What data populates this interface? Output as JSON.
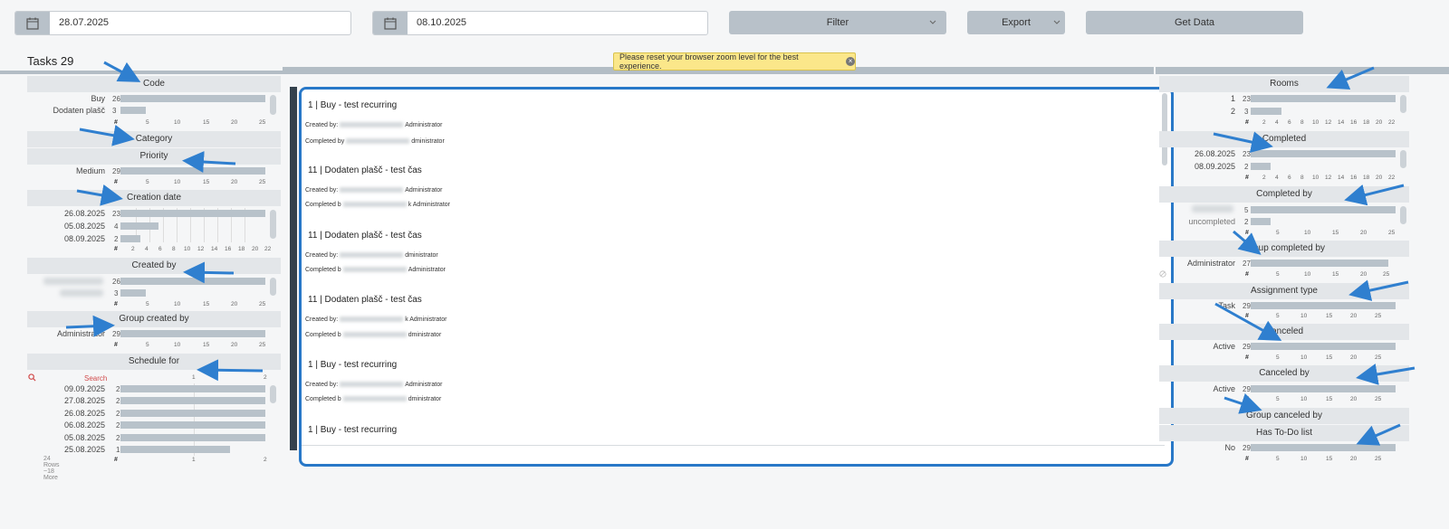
{
  "toolbar": {
    "date_from": "28.07.2025",
    "date_to": "08.10.2025",
    "filter_label": "Filter",
    "export_label": "Export",
    "get_data_label": "Get Data"
  },
  "tasks_title": "Tasks 29",
  "toast": "Please reset your browser zoom level for the best experience.",
  "left": {
    "code": {
      "header": "Code",
      "rows": [
        {
          "label": "Buy",
          "count": "26"
        },
        {
          "label": "Dodaten plašč",
          "count": "3"
        }
      ],
      "ticks": [
        "#",
        "5",
        "10",
        "15",
        "20",
        "25"
      ]
    },
    "category": {
      "header": "Category"
    },
    "priority": {
      "header": "Priority",
      "rows": [
        {
          "label": "Medium",
          "count": "29"
        }
      ],
      "ticks": [
        "#",
        "5",
        "10",
        "15",
        "20",
        "25"
      ]
    },
    "creation_date": {
      "header": "Creation date",
      "rows": [
        {
          "label": "26.08.2025",
          "count": "23"
        },
        {
          "label": "05.08.2025",
          "count": "4"
        },
        {
          "label": "08.09.2025",
          "count": "2"
        }
      ],
      "ticks": [
        "#",
        "2",
        "4",
        "6",
        "8",
        "10",
        "12",
        "14",
        "16",
        "18",
        "20",
        "22"
      ]
    },
    "created_by": {
      "header": "Created by",
      "rows": [
        {
          "label": "",
          "count": "26"
        },
        {
          "label": "",
          "count": "3"
        }
      ],
      "ticks": [
        "#",
        "5",
        "10",
        "15",
        "20",
        "25"
      ]
    },
    "group_created_by": {
      "header": "Group created by",
      "rows": [
        {
          "label": "Administrator",
          "count": "29"
        }
      ],
      "ticks": [
        "#",
        "5",
        "10",
        "15",
        "20",
        "25"
      ]
    },
    "schedule_for": {
      "header": "Schedule for",
      "search": "Search",
      "top_ticks": [
        "1",
        "2"
      ],
      "rows": [
        {
          "label": "09.09.2025",
          "count": "2"
        },
        {
          "label": "27.08.2025",
          "count": "2"
        },
        {
          "label": "26.08.2025",
          "count": "2"
        },
        {
          "label": "06.08.2025",
          "count": "2"
        },
        {
          "label": "05.08.2025",
          "count": "2"
        },
        {
          "label": "25.08.2025",
          "count": "1"
        }
      ],
      "footer": "24 Rows ~18 More",
      "ticks": [
        "#",
        "1",
        "2"
      ]
    }
  },
  "right": {
    "rooms": {
      "header": "Rooms",
      "rows": [
        {
          "label": "1",
          "count": "23"
        },
        {
          "label": "2",
          "count": "3"
        }
      ],
      "ticks": [
        "#",
        "2",
        "4",
        "6",
        "8",
        "10",
        "12",
        "14",
        "16",
        "18",
        "20",
        "22"
      ]
    },
    "completed": {
      "header": "Completed",
      "rows": [
        {
          "label": "26.08.2025",
          "count": "23"
        },
        {
          "label": "08.09.2025",
          "count": "2"
        }
      ],
      "ticks": [
        "#",
        "2",
        "4",
        "6",
        "8",
        "10",
        "12",
        "14",
        "16",
        "18",
        "20",
        "22"
      ]
    },
    "completed_by": {
      "header": "Completed by",
      "rows": [
        {
          "label": "",
          "count": "5"
        },
        {
          "label": "uncompleted",
          "count": "2"
        }
      ],
      "ticks": [
        "#",
        "5",
        "10",
        "15",
        "20",
        "25"
      ]
    },
    "group_completed_by": {
      "header": "Group completed by",
      "rows": [
        {
          "label": "Administrator",
          "count": "27"
        }
      ],
      "ticks": [
        "#",
        "5",
        "10",
        "15",
        "20",
        "25"
      ]
    },
    "assignment_type": {
      "header": "Assignment type",
      "rows": [
        {
          "label": "Task",
          "count": "29"
        }
      ],
      "ticks": [
        "#",
        "5",
        "10",
        "15",
        "20",
        "25"
      ]
    },
    "canceled": {
      "header": "Canceled",
      "rows": [
        {
          "label": "Active",
          "count": "29"
        }
      ],
      "ticks": [
        "#",
        "5",
        "10",
        "15",
        "20",
        "25"
      ]
    },
    "canceled_by": {
      "header": "Canceled by",
      "rows": [
        {
          "label": "Active",
          "count": "29"
        }
      ],
      "ticks": [
        "#",
        "5",
        "10",
        "15",
        "20",
        "25"
      ]
    },
    "group_canceled_by": {
      "header": "Group canceled by"
    },
    "has_todo": {
      "header": "Has To-Do list",
      "rows": [
        {
          "label": "No",
          "count": "29"
        }
      ],
      "ticks": [
        "#",
        "5",
        "10",
        "15",
        "20",
        "25"
      ]
    }
  },
  "tasks": [
    {
      "title": "1 | Buy - test recurring",
      "created": "Created by:",
      "created_tail": "Administrator",
      "completed": "Completed by",
      "completed_tail": "dministrator"
    },
    {
      "title": "11 | Dodaten plašč - test čas",
      "created": "Created by:",
      "created_tail": "Administrator",
      "completed": "Completed b",
      "completed_tail": "k Administrator"
    },
    {
      "title": "11 | Dodaten plašč - test čas",
      "created": "Created by:",
      "created_tail": "dministrator",
      "completed": "Completed b",
      "completed_tail": "Administrator"
    },
    {
      "title": "11 | Dodaten plašč - test čas",
      "created": "Created by:",
      "created_tail": "k Administrator",
      "completed": "Completed b",
      "completed_tail": "dministrator"
    },
    {
      "title": "1 | Buy - test recurring",
      "created": "Created by:",
      "created_tail": "Administrator",
      "completed": "Completed b",
      "completed_tail": "dministrator"
    },
    {
      "title": "1 | Buy - test recurring",
      "created": "",
      "created_tail": "",
      "completed": "",
      "completed_tail": ""
    }
  ],
  "colors": {
    "accent": "#2878c8",
    "bar": "#b8c2ca",
    "arrow": "#2f7fcf",
    "toast": "#fbe78a"
  }
}
